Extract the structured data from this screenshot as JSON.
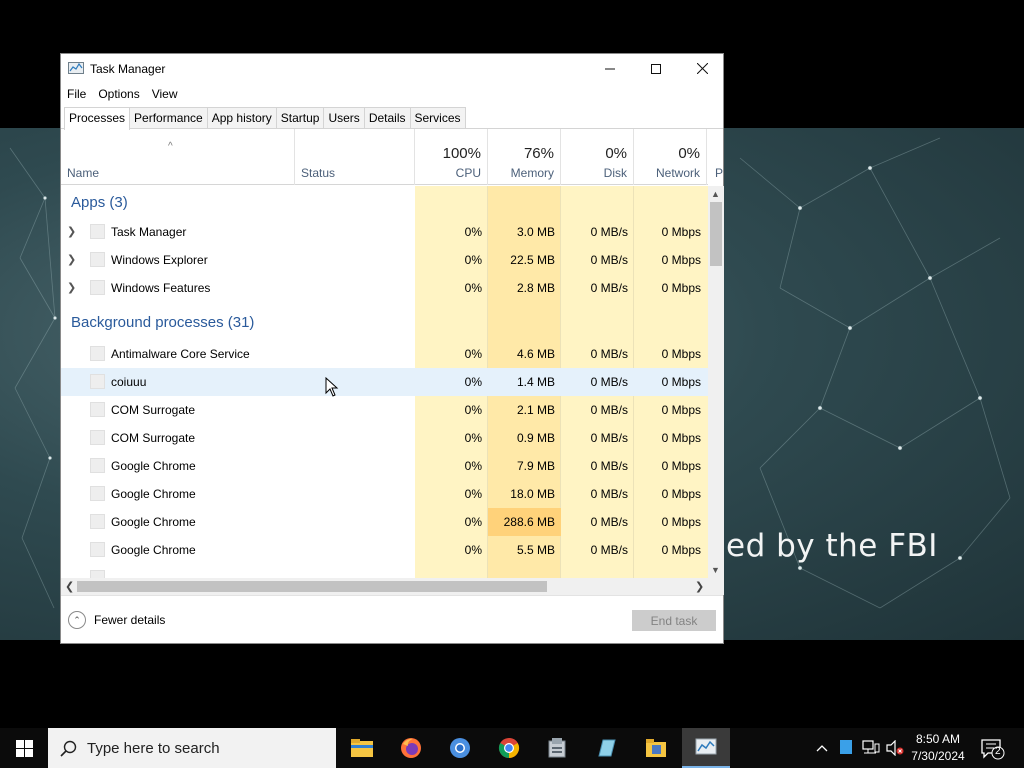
{
  "window": {
    "title": "Task Manager",
    "menu": [
      "File",
      "Options",
      "View"
    ],
    "tabs": [
      "Processes",
      "Performance",
      "App history",
      "Startup",
      "Users",
      "Details",
      "Services"
    ],
    "active_tab": "Processes"
  },
  "columns": {
    "name": "Name",
    "status": "Status",
    "cpu": {
      "pct": "100%",
      "label": "CPU"
    },
    "memory": {
      "pct": "76%",
      "label": "Memory"
    },
    "disk": {
      "pct": "0%",
      "label": "Disk"
    },
    "network": {
      "pct": "0%",
      "label": "Network"
    },
    "power_partial": "P"
  },
  "groups": {
    "apps": "Apps (3)",
    "background": "Background processes (31)"
  },
  "apps": [
    {
      "name": "Task Manager",
      "cpu": "0%",
      "memory": "3.0 MB",
      "disk": "0 MB/s",
      "network": "0 Mbps"
    },
    {
      "name": "Windows Explorer",
      "cpu": "0%",
      "memory": "22.5 MB",
      "disk": "0 MB/s",
      "network": "0 Mbps"
    },
    {
      "name": "Windows Features",
      "cpu": "0%",
      "memory": "2.8 MB",
      "disk": "0 MB/s",
      "network": "0 Mbps"
    }
  ],
  "background": [
    {
      "name": "Antimalware Core Service",
      "cpu": "0%",
      "memory": "4.6 MB",
      "disk": "0 MB/s",
      "network": "0 Mbps"
    },
    {
      "name": "coiuuu",
      "cpu": "0%",
      "memory": "1.4 MB",
      "disk": "0 MB/s",
      "network": "0 Mbps"
    },
    {
      "name": "COM Surrogate",
      "cpu": "0%",
      "memory": "2.1 MB",
      "disk": "0 MB/s",
      "network": "0 Mbps"
    },
    {
      "name": "COM Surrogate",
      "cpu": "0%",
      "memory": "0.9 MB",
      "disk": "0 MB/s",
      "network": "0 Mbps"
    },
    {
      "name": "Google Chrome",
      "cpu": "0%",
      "memory": "7.9 MB",
      "disk": "0 MB/s",
      "network": "0 Mbps"
    },
    {
      "name": "Google Chrome",
      "cpu": "0%",
      "memory": "18.0 MB",
      "disk": "0 MB/s",
      "network": "0 Mbps"
    },
    {
      "name": "Google Chrome",
      "cpu": "0%",
      "memory": "288.6 MB",
      "disk": "0 MB/s",
      "network": "0 Mbps"
    },
    {
      "name": "Google Chrome",
      "cpu": "0%",
      "memory": "5.5 MB",
      "disk": "0 MB/s",
      "network": "0 Mbps"
    }
  ],
  "footer": {
    "fewer_details": "Fewer details",
    "end_task": "End task"
  },
  "desktop": {
    "background_text": "ed by the FBI"
  },
  "taskbar": {
    "search_placeholder": "Type here to search",
    "time": "8:50 AM",
    "date": "7/30/2024",
    "notification_count": "2",
    "apps": [
      "file-explorer-icon",
      "firefox-icon",
      "chromium-icon",
      "chrome-icon",
      "app-icon",
      "app-icon",
      "app-icon",
      "task-manager-icon"
    ]
  },
  "colors": {
    "cpu_col": "#fff4c4",
    "mem_col": "#ffe9a8",
    "mem_high": "#ffd27a",
    "group_title": "#2a5a9b",
    "header_label": "#4c607a"
  }
}
